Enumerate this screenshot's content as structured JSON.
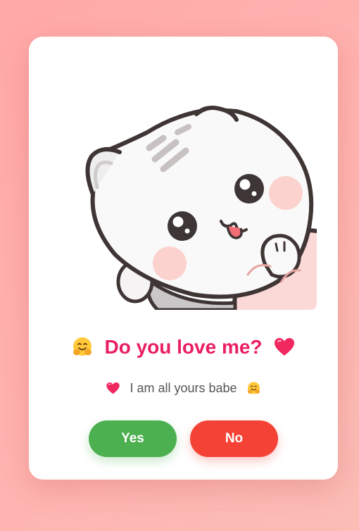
{
  "card": {
    "image_subject": "cute white cat hugging",
    "title": "Do you love me?",
    "title_leading_icon": "hugging-face-emoji",
    "title_trailing_icon": "heart-emoji",
    "subtitle": "I am all yours babe",
    "subtitle_leading_icon": "heart-emoji",
    "subtitle_trailing_icon": "hugging-face-emoji"
  },
  "buttons": {
    "yes_label": "Yes",
    "no_label": "No"
  },
  "colors": {
    "background": "#ffaeab",
    "card": "#ffffff",
    "title": "#e91e63",
    "subtitle": "#555555",
    "yes": "#4caf50",
    "no": "#f44336"
  }
}
